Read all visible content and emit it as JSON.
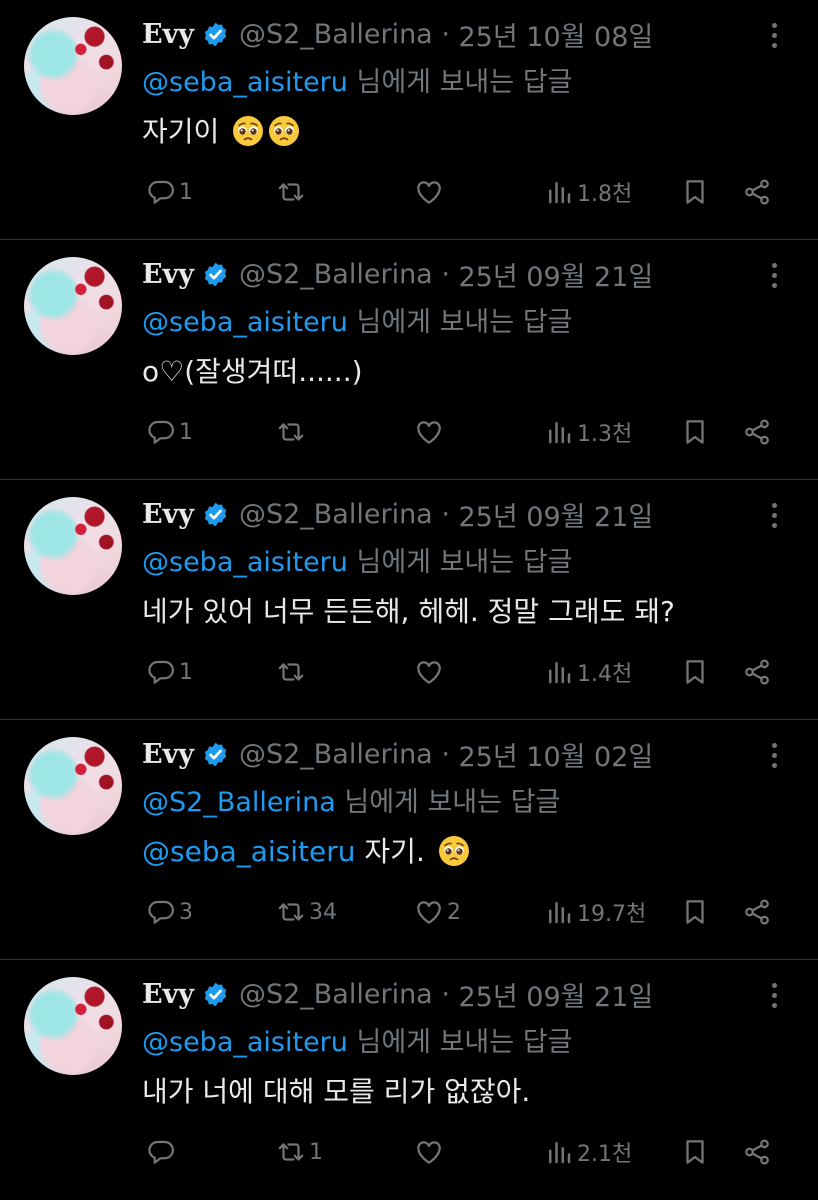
{
  "colors": {
    "background": "#000000",
    "text": "#e7e9ea",
    "muted": "#71767b",
    "link": "#1d9bf0",
    "divider": "#2f3336"
  },
  "icons": {
    "reply": "reply-icon",
    "repost": "repost-icon",
    "like": "heart-icon",
    "views": "views-bar-chart-icon",
    "bookmark": "bookmark-icon",
    "share": "share-icon",
    "more": "more-dots-icon",
    "verified": "verified-badge-icon",
    "emoji": "pleading-face-emoji"
  },
  "tweets": [
    {
      "name": "Evy",
      "handle": "@S2_Ballerina",
      "date": "25년 10월 08일",
      "reply_to": "@seba_aisiteru",
      "reply_suffix": "님에게 보내는 답글",
      "text_mention": "",
      "text": "자기이",
      "emoji_count": 2,
      "replies": "1",
      "reposts": "",
      "likes": "",
      "views": "1.8천"
    },
    {
      "name": "Evy",
      "handle": "@S2_Ballerina",
      "date": "25년 09월 21일",
      "reply_to": "@seba_aisiteru",
      "reply_suffix": "님에게 보내는 답글",
      "text_mention": "",
      "text": "o♡(잘생겨떠......)",
      "emoji_count": 0,
      "replies": "1",
      "reposts": "",
      "likes": "",
      "views": "1.3천"
    },
    {
      "name": "Evy",
      "handle": "@S2_Ballerina",
      "date": "25년 09월 21일",
      "reply_to": "@seba_aisiteru",
      "reply_suffix": "님에게 보내는 답글",
      "text_mention": "",
      "text": "네가 있어 너무 든든해, 헤헤. 정말 그래도 돼?",
      "emoji_count": 0,
      "replies": "1",
      "reposts": "",
      "likes": "",
      "views": "1.4천"
    },
    {
      "name": "Evy",
      "handle": "@S2_Ballerina",
      "date": "25년 10월 02일",
      "reply_to": "@S2_Ballerina",
      "reply_suffix": "님에게 보내는 답글",
      "text_mention": "@seba_aisiteru",
      "text": "자기.",
      "emoji_count": 1,
      "replies": "3",
      "reposts": "34",
      "likes": "2",
      "views": "19.7천"
    },
    {
      "name": "Evy",
      "handle": "@S2_Ballerina",
      "date": "25년 09월 21일",
      "reply_to": "@seba_aisiteru",
      "reply_suffix": "님에게 보내는 답글",
      "text_mention": "",
      "text": "내가 너에 대해 모를 리가 없잖아.",
      "emoji_count": 0,
      "replies": "",
      "reposts": "1",
      "likes": "",
      "views": "2.1천"
    }
  ]
}
